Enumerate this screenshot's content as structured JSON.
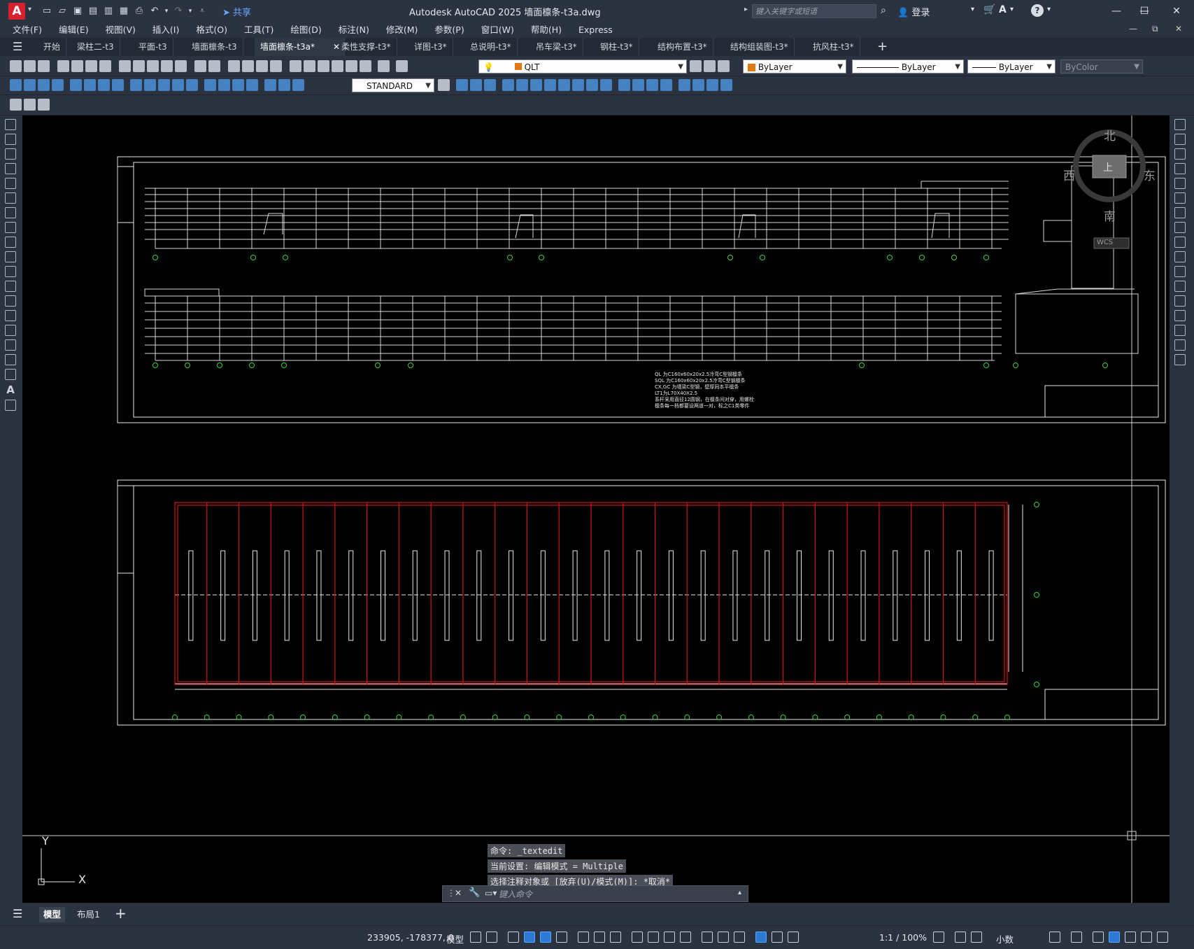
{
  "titlebar": {
    "logo": "A",
    "share_label": "共享",
    "title": "Autodesk AutoCAD 2025    墙面檩条-t3a.dwg",
    "search_placeholder": "键入关键字或短语",
    "login_label": "登录"
  },
  "menu": [
    "文件(F)",
    "编辑(E)",
    "视图(V)",
    "插入(I)",
    "格式(O)",
    "工具(T)",
    "绘图(D)",
    "标注(N)",
    "修改(M)",
    "参数(P)",
    "窗口(W)",
    "帮助(H)",
    "Express"
  ],
  "tabs": [
    {
      "label": "开始"
    },
    {
      "label": "梁柱二-t3"
    },
    {
      "label": "平面-t3"
    },
    {
      "label": "墙面檩条-t3"
    },
    {
      "label": "墙面檩条-t3a*",
      "active": true
    },
    {
      "label": "柔性支撑-t3*"
    },
    {
      "label": "详图-t3*"
    },
    {
      "label": "总说明-t3*"
    },
    {
      "label": "吊车梁-t3*"
    },
    {
      "label": "钢柱-t3*"
    },
    {
      "label": "结构布置-t3*"
    },
    {
      "label": "结构组装图-t3*"
    },
    {
      "label": "抗风柱-t3*"
    }
  ],
  "properties": {
    "layer": "QLT",
    "color": "ByLayer",
    "linetype": "ByLayer",
    "lineweight": "ByLayer",
    "plotstyle": "ByColor",
    "textstyle": "STANDARD",
    "layer_color": "#e07a10"
  },
  "viewcube": {
    "north": "北",
    "south": "南",
    "east": "东",
    "west": "西",
    "top": "上",
    "wcs": "WCS"
  },
  "ucs": {
    "x": "X",
    "y": "Y"
  },
  "drawing": {
    "notes": [
      "QL 为C160x60x20x2.5冷弯C型钢檩条",
      "SQL 为C160x60x20x2.5冷弯C型钢檩条",
      "CX,GC 为墙梁C型钢，壁厚同本平檩条",
      "LT1为L70X40X2.5",
      "系杆采用直径12圆钢，在檩条间对穿，用螺栓",
      "檩条每一档都要设两道一对，标之C1类零件"
    ]
  },
  "command": {
    "history": [
      "命令: _textedit",
      "当前设置: 编辑模式 = Multiple",
      "选择注释对象或 [放弃(U)/模式(M)]: *取消*"
    ],
    "placeholder": "键入命令"
  },
  "layouts": [
    {
      "label": "模型",
      "active": true
    },
    {
      "label": "布局1"
    }
  ],
  "status": {
    "coords": "233905, -178377, 0",
    "model": "模型",
    "scale": "1:1 / 100%",
    "units": "小数"
  },
  "colors": {
    "red_line": "#d21414",
    "green_marker": "#3ccf3c",
    "white_line": "#e8e8e8"
  }
}
